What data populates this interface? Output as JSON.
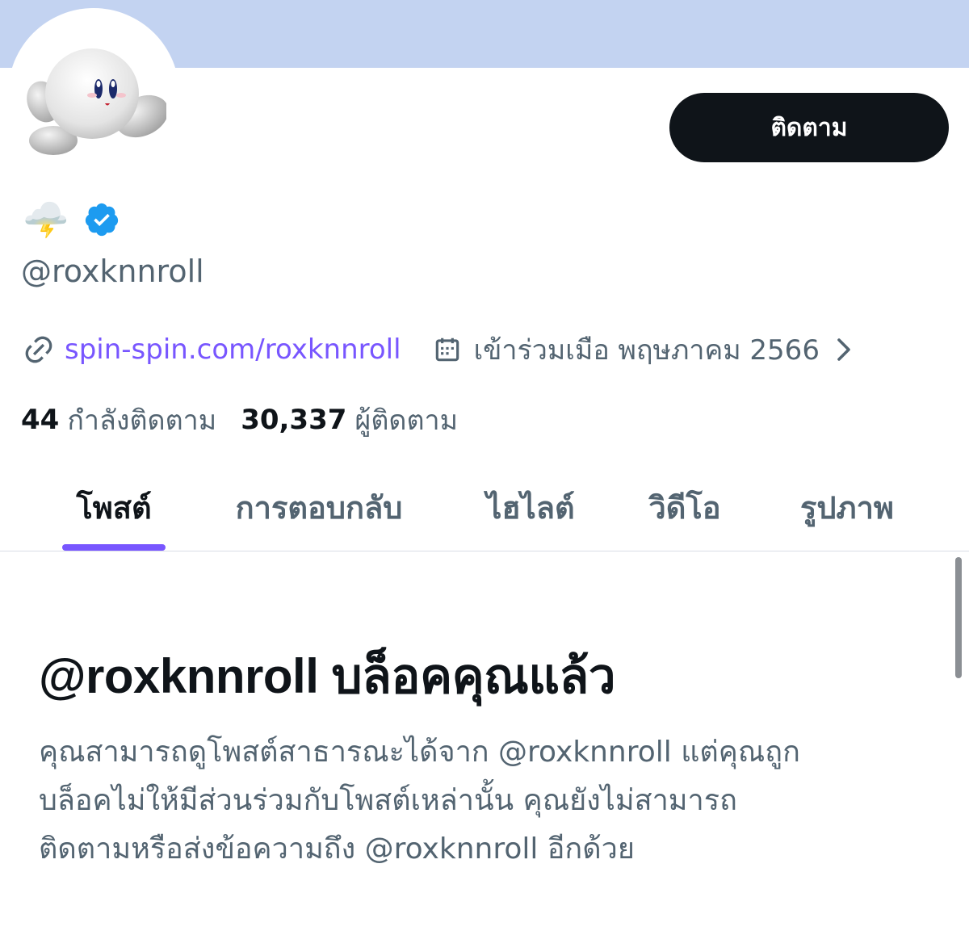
{
  "profile": {
    "follow_label": "ติดตาม",
    "display_name_emoji": "🌩️",
    "verified": true,
    "handle": "@roxknnroll",
    "website": "spin-spin.com/roxknnroll",
    "joined": "เข้าร่วมเมือ พฤษภาคม 2566",
    "following_count": "44",
    "following_label": "กำลังติดตาม",
    "followers_count": "30,337",
    "followers_label": "ผู้ติดตาม"
  },
  "tabs": [
    {
      "label": "โพสต์",
      "active": true
    },
    {
      "label": "การตอบกลับ",
      "active": false
    },
    {
      "label": "ไฮไลต์",
      "active": false
    },
    {
      "label": "วิดีโอ",
      "active": false
    },
    {
      "label": "รูปภาพ",
      "active": false
    }
  ],
  "blocked": {
    "title": "@roxknnroll บล็อคคุณแล้ว",
    "line1": "คุณสามารถดูโพสต์สาธารณะได้จาก @roxknnroll แต่คุณถูก",
    "line2": "บล็อคไม่ให้มีส่วนร่วมกับโพสต์เหล่านั้น คุณยังไม่สามารถ",
    "line3": "ติดตามหรือส่งข้อความถึง @roxknnroll อีกด้วย"
  },
  "colors": {
    "banner": "#c3d3f1",
    "accent": "#7856ff",
    "verified": "#1d9bf0",
    "button": "#0f1419",
    "secondary_text": "#536471"
  },
  "icons": {
    "avatar": "kirby-avatar",
    "verified": "verified-badge-icon",
    "link": "link-icon",
    "calendar": "calendar-icon",
    "chevron": "chevron-right-icon"
  }
}
